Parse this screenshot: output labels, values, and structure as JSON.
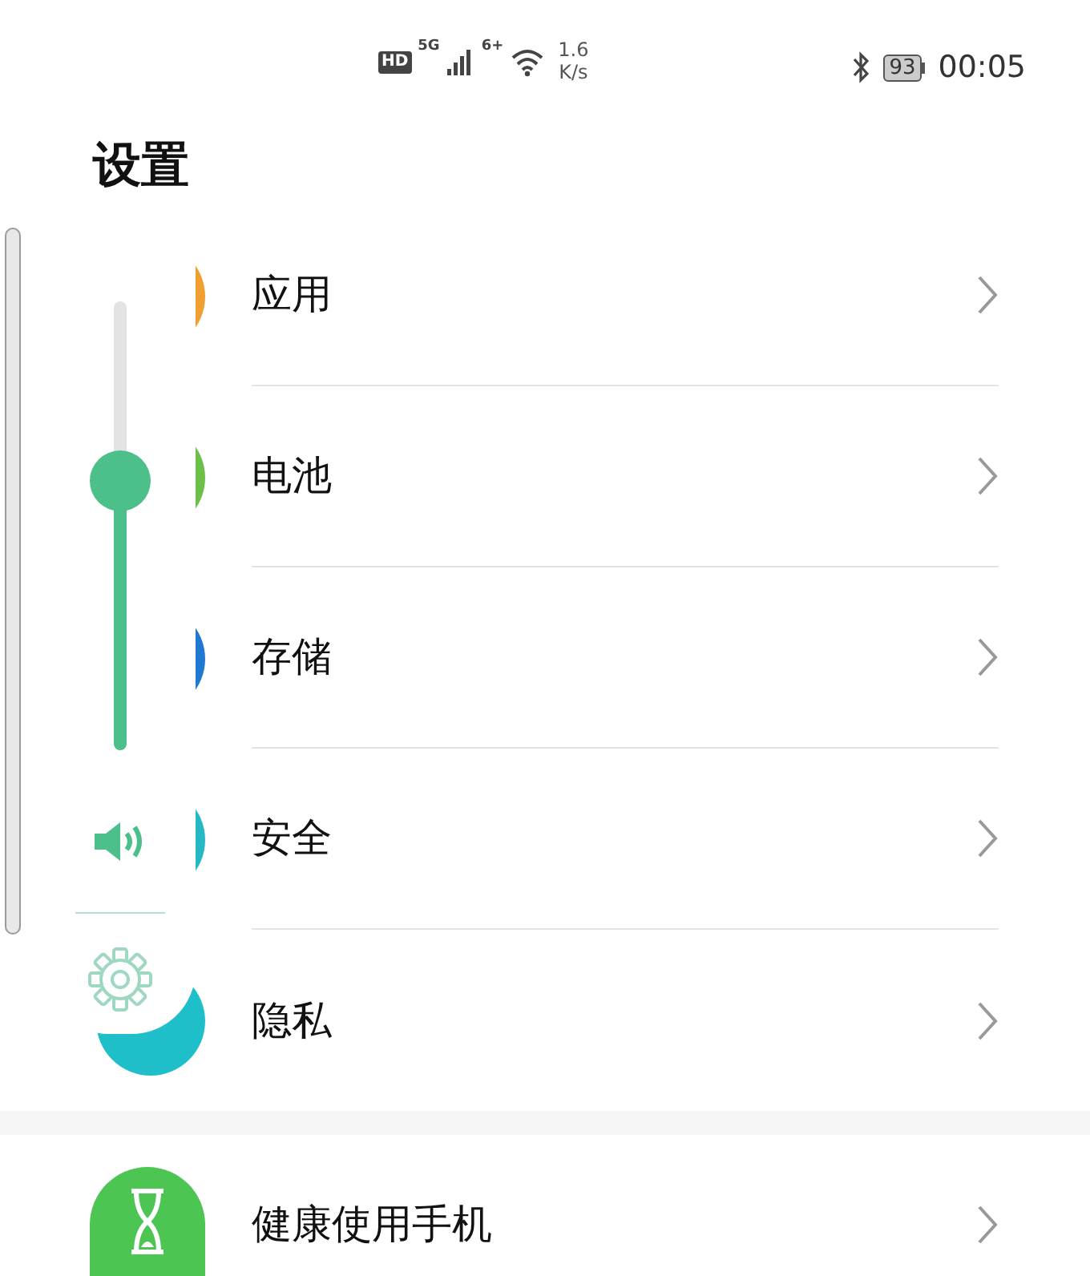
{
  "status_bar": {
    "hd": "HD",
    "network": "5G",
    "wifi": "6+",
    "speed_value": "1.6",
    "speed_unit": "K/s",
    "battery": "93",
    "time": "00:05"
  },
  "title": "设置",
  "groups": [
    {
      "items": [
        {
          "label": "应用",
          "color": "#f0a030",
          "kind": "circle"
        },
        {
          "label": "电池",
          "color": "#6cc04a",
          "kind": "circle"
        },
        {
          "label": "存储",
          "color": "#1f78d1",
          "kind": "circle"
        },
        {
          "label": "安全",
          "color": "#26b8c6",
          "kind": "circle"
        },
        {
          "label": "隐私",
          "color": "#1fbfc9",
          "kind": "circle"
        }
      ]
    },
    {
      "items": [
        {
          "label": "健康使用手机",
          "color": "#4cc552",
          "kind": "hourglass"
        }
      ]
    }
  ],
  "volume_panel": {
    "level": 0.6
  }
}
